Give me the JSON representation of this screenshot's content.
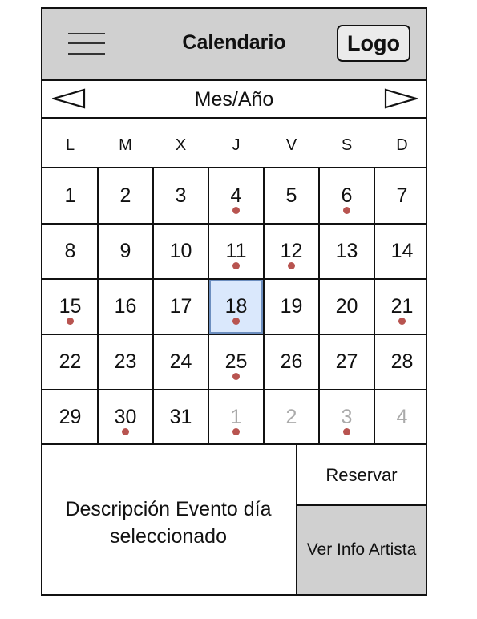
{
  "header": {
    "title": "Calendario",
    "logo_label": "Logo",
    "menu_icon": "hamburger-menu-icon"
  },
  "month_nav": {
    "label": "Mes/Año",
    "prev_icon": "triangle-left-icon",
    "next_icon": "triangle-right-icon"
  },
  "weekdays": [
    "L",
    "M",
    "X",
    "J",
    "V",
    "S",
    "D"
  ],
  "days": [
    {
      "label": "1",
      "current": true,
      "event": false
    },
    {
      "label": "2",
      "current": true,
      "event": false
    },
    {
      "label": "3",
      "current": true,
      "event": false
    },
    {
      "label": "4",
      "current": true,
      "event": true
    },
    {
      "label": "5",
      "current": true,
      "event": false
    },
    {
      "label": "6",
      "current": true,
      "event": true
    },
    {
      "label": "7",
      "current": true,
      "event": false
    },
    {
      "label": "8",
      "current": true,
      "event": false
    },
    {
      "label": "9",
      "current": true,
      "event": false
    },
    {
      "label": "10",
      "current": true,
      "event": false
    },
    {
      "label": "11",
      "current": true,
      "event": true
    },
    {
      "label": "12",
      "current": true,
      "event": true
    },
    {
      "label": "13",
      "current": true,
      "event": false
    },
    {
      "label": "14",
      "current": true,
      "event": false
    },
    {
      "label": "15",
      "current": true,
      "event": true
    },
    {
      "label": "16",
      "current": true,
      "event": false
    },
    {
      "label": "17",
      "current": true,
      "event": false
    },
    {
      "label": "18",
      "current": true,
      "event": true,
      "selected": true
    },
    {
      "label": "19",
      "current": true,
      "event": false
    },
    {
      "label": "20",
      "current": true,
      "event": false
    },
    {
      "label": "21",
      "current": true,
      "event": true
    },
    {
      "label": "22",
      "current": true,
      "event": false
    },
    {
      "label": "23",
      "current": true,
      "event": false
    },
    {
      "label": "24",
      "current": true,
      "event": false
    },
    {
      "label": "25",
      "current": true,
      "event": true
    },
    {
      "label": "26",
      "current": true,
      "event": false
    },
    {
      "label": "27",
      "current": true,
      "event": false
    },
    {
      "label": "28",
      "current": true,
      "event": false
    },
    {
      "label": "29",
      "current": true,
      "event": false
    },
    {
      "label": "30",
      "current": true,
      "event": true
    },
    {
      "label": "31",
      "current": true,
      "event": false
    },
    {
      "label": "1",
      "current": false,
      "event": true
    },
    {
      "label": "2",
      "current": false,
      "event": false
    },
    {
      "label": "3",
      "current": false,
      "event": true
    },
    {
      "label": "4",
      "current": false,
      "event": false
    }
  ],
  "description": {
    "text": "Descripción Evento día seleccionado"
  },
  "actions": {
    "reserve_label": "Reservar",
    "artist_info_label": "Ver Info Artista"
  },
  "colors": {
    "header_bg": "#d0d0d0",
    "selected_day": "#dae8fc",
    "selected_border": "#6c8ebf",
    "event_dot": "#b85450",
    "muted_text": "#aaaaaa"
  }
}
